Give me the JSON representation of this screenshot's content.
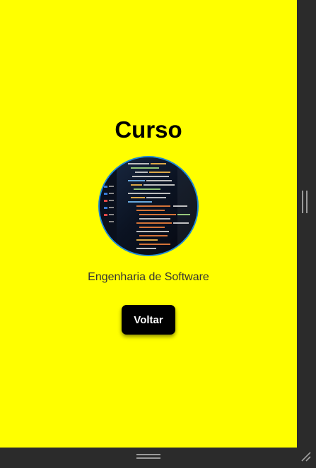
{
  "page": {
    "title": "Curso",
    "subtitle": "Engenharia de Software",
    "back_button_label": "Voltar",
    "background_color": "#ffff00",
    "avatar_icon": "code-screen-image"
  }
}
